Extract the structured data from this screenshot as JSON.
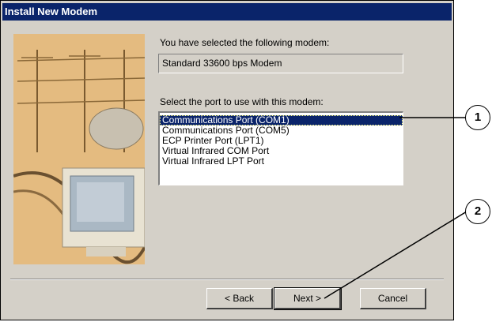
{
  "window": {
    "title": "Install New Modem"
  },
  "selected_modem": {
    "label": "You have selected the following modem:",
    "value": "Standard 33600 bps Modem"
  },
  "port": {
    "label": "Select the port to use with this modem:",
    "items": [
      "Communications Port (COM1)",
      "Communications Port (COM5)",
      "ECP Printer Port (LPT1)",
      "Virtual Infrared COM Port",
      "Virtual Infrared LPT Port"
    ],
    "selected_index": 0
  },
  "buttons": {
    "back": "< Back",
    "next": "Next >",
    "cancel": "Cancel"
  },
  "callouts": {
    "one": "1",
    "two": "2"
  },
  "colors": {
    "title_bar": "#0a246a",
    "dialog_bg": "#d4d0c8",
    "selection": "#0a246a"
  }
}
